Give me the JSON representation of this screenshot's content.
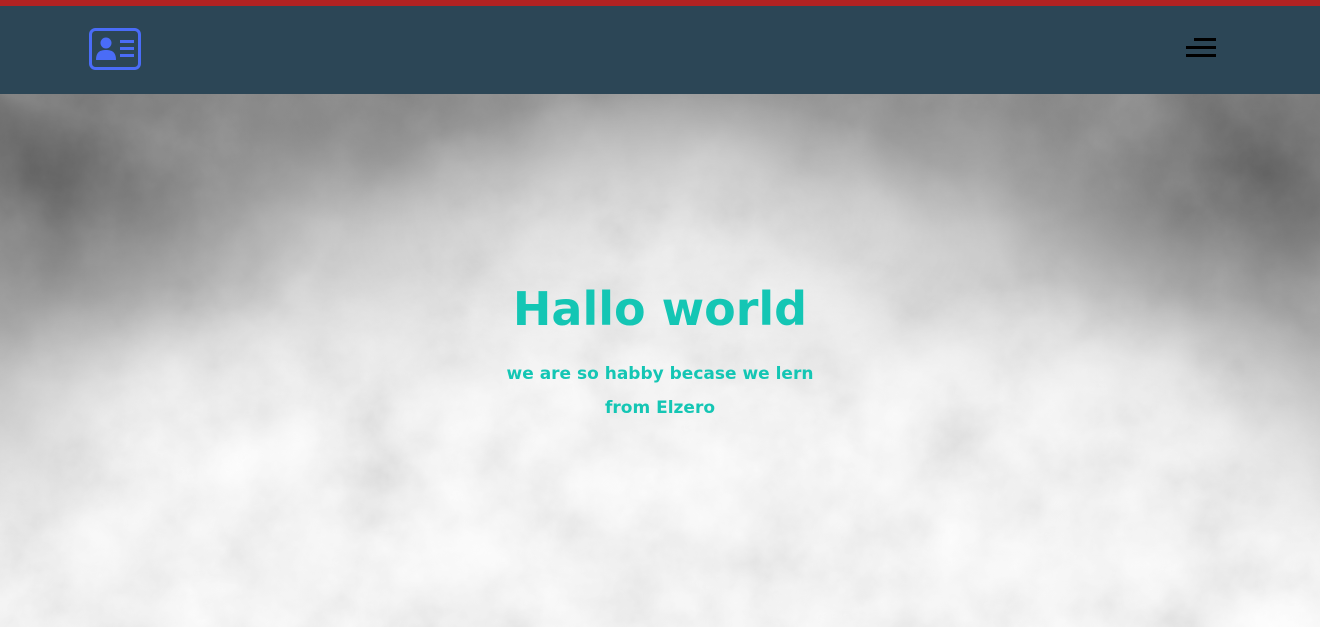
{
  "header": {
    "logo_icon": "contact-card-icon",
    "menu_icon": "hamburger-menu-icon",
    "accent_border": "#b22222",
    "background": "#2c4656",
    "logo_color": "#4a6cf7"
  },
  "hero": {
    "title": "Hallo world",
    "subtitle": "we are so habby becase we lern from Elzero",
    "text_color": "#14c6b4"
  }
}
